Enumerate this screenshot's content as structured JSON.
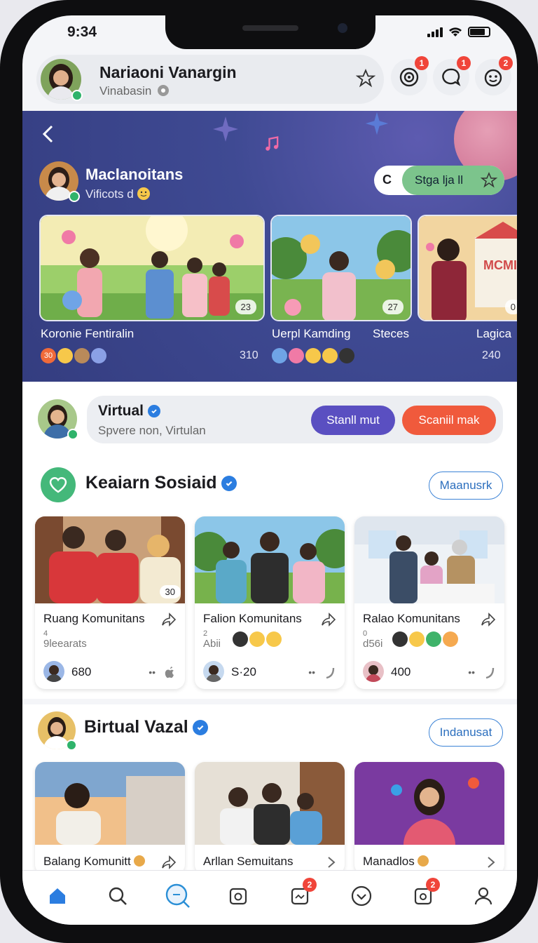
{
  "status": {
    "time": "9:34"
  },
  "header": {
    "name": "Nariaoni Vanargin",
    "subtitle": "Vinabasin",
    "badges": [
      "1",
      "1",
      "2"
    ]
  },
  "hero": {
    "name": "Maclanoitans",
    "subtitle": "Vificots d",
    "pill_left": "C",
    "pill_label": "Stga lja ll",
    "cards": [
      {
        "title": "Koronie Fentiralin",
        "count": "23",
        "num": "310",
        "label_a": "30"
      },
      {
        "title": "Uerpl Kamding",
        "count": "27",
        "num": ""
      },
      {
        "title": "Steces",
        "count": "",
        "num": ""
      },
      {
        "title": "Lagica",
        "count": "0",
        "num": "240",
        "sign": "MCMI"
      }
    ]
  },
  "virtual": {
    "title": "Virtual",
    "subtitle": "Spvere non, Virtulan",
    "btn_primary": "Stanll mut",
    "btn_secondary": "Scaniil mak"
  },
  "section1": {
    "title": "Keaiarn Sosiaid",
    "action": "Maanusrk",
    "cards": [
      {
        "title": "Ruang Komunitans",
        "sub": "4",
        "sub2": "9leearats",
        "count": "680",
        "badge": "30"
      },
      {
        "title": "Falion Komunitans",
        "sub": "2",
        "sub2": "Abii",
        "count": "S·20"
      },
      {
        "title": "Ralao Komunitans",
        "sub": "0",
        "sub2": "d56i",
        "count": "400"
      }
    ]
  },
  "section2": {
    "title": "Birtual Vazal",
    "action": "Indanusat",
    "cards": [
      {
        "title": "Balang Komunitt"
      },
      {
        "title": "Arllan Semuitans"
      },
      {
        "title": "Manadlos"
      }
    ]
  },
  "tabbar": {
    "badges": [
      "2",
      "2"
    ]
  },
  "colors": {
    "accent": "#2b7de0",
    "hero": "#3f4a93",
    "primary_btn": "#5a4fc1",
    "secondary_btn": "#f05a3c"
  }
}
